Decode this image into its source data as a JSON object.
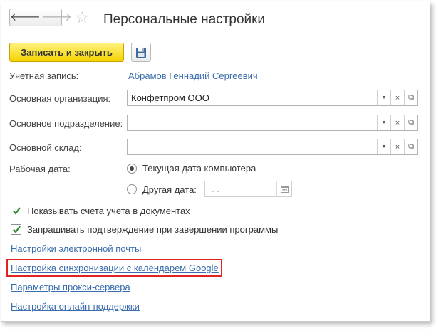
{
  "header": {
    "back_glyph": "🡐",
    "forward_glyph": "🡒",
    "favorite_glyph": "☆",
    "title": "Персональные настройки"
  },
  "toolbar": {
    "save_close_label": "Записать и закрыть",
    "save_icon": "floppy-disk-icon"
  },
  "form": {
    "account": {
      "label": "Учетная запись:",
      "value": "Абрамов Геннадий Сергеевич"
    },
    "organization": {
      "label": "Основная организация:",
      "value": "Конфетпром ООО"
    },
    "department": {
      "label": "Основное подразделение:",
      "value": ""
    },
    "warehouse": {
      "label": "Основной склад:",
      "value": ""
    },
    "work_date": {
      "label": "Рабочая дата:",
      "option_current": "Текущая дата компьютера",
      "option_other": "Другая дата:",
      "selected": "option_current",
      "date_value": ". ."
    },
    "field_buttons": {
      "dropdown": "▼",
      "clear": "×",
      "open": "⧉"
    }
  },
  "checkboxes": [
    {
      "label": "Показывать счета учета в документах",
      "checked": true
    },
    {
      "label": "Запрашивать подтверждение при завершении программы",
      "checked": true
    }
  ],
  "links": {
    "email": "Настройки электронной почты",
    "google_calendar": "Настройка синхронизации с календарем Google",
    "proxy": "Параметры прокси-сервера",
    "online_support": "Настройка онлайн-поддержки"
  },
  "colors": {
    "primary_button": "#f4d300",
    "link": "#3a6cad",
    "highlight": "#e02323"
  }
}
